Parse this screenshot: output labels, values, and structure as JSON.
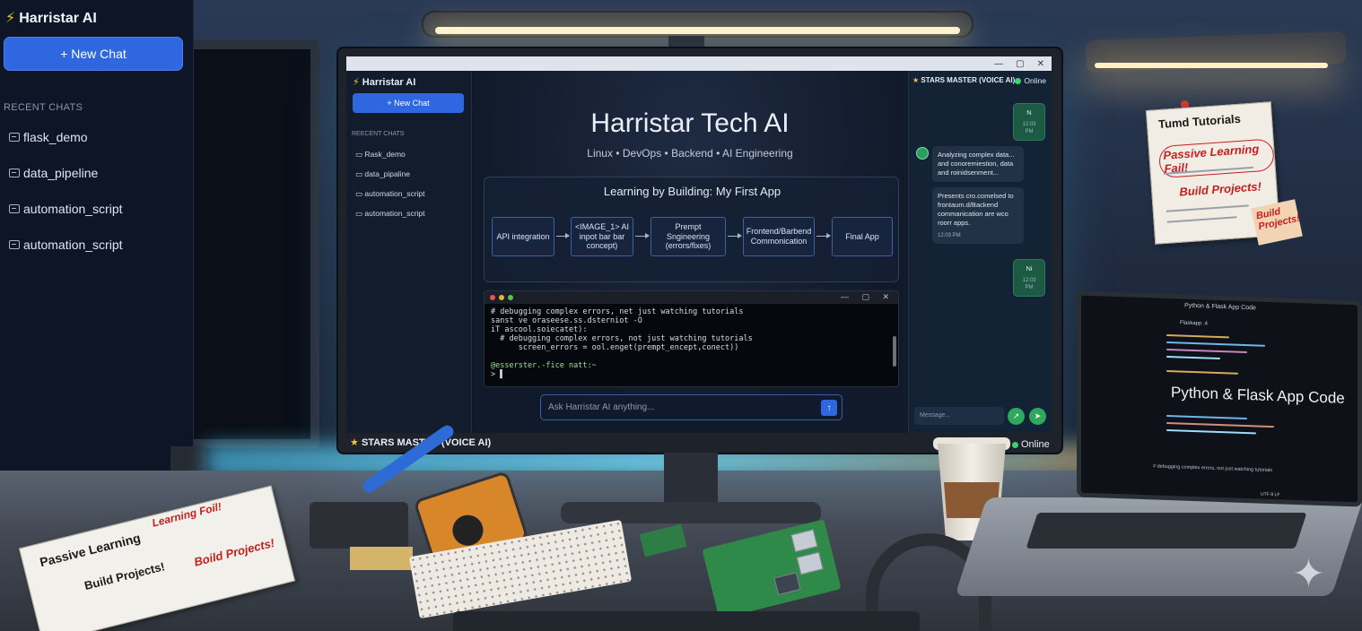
{
  "sidebar": {
    "brand": "Harristar AI",
    "new_chat": "+ New Chat",
    "recent_heading": "RECENT CHATS",
    "items": [
      {
        "label": "flask_demo"
      },
      {
        "label": "data_pipeline"
      },
      {
        "label": "automation_script"
      },
      {
        "label": "automation_script"
      }
    ]
  },
  "monitor": {
    "window_controls": [
      "—",
      "▢",
      "✕"
    ],
    "app_sidebar": {
      "brand": "Harristar AI",
      "new_chat": "+ New Chat",
      "recent_heading": "REECENT CHATS",
      "items": [
        {
          "label": "Rask_demo"
        },
        {
          "label": "data_pipaline"
        },
        {
          "label": "automation_script"
        },
        {
          "label": "automation_script"
        }
      ]
    },
    "hero": {
      "title": "Harristar Tech AI",
      "subtitle": "Linux • DevOps • Backend • AI Engineering"
    },
    "flow": {
      "title": "Learning by Building: My First App",
      "nodes": [
        "API integration",
        "<IMAGE_1> AI inpot bar bar concept)",
        "Prempt Sngineering (errors/fixes)",
        "Frontend/Barbend Commonication",
        "Final App"
      ]
    },
    "terminal": {
      "controls": "— ▢ ✕",
      "lines": [
        "# debugging complex errors, net just watching tutorials",
        "sanst ve oraseese.ss.dsterniot -O",
        "iT ascool.soiecatet):",
        "  # debugging complex errors, not just watching tutorials",
        "      screen_errors = ool.enget(prempt_encept,conect))",
        "",
        "@esserster.-fice natt:~",
        "> ▌"
      ]
    },
    "ask_placeholder": "Ask Harristar AI anything...",
    "voice_panel": {
      "title": "STARS MASTER (VOICE AI)",
      "status": "Online",
      "messages": [
        {
          "role": "user",
          "text": "N",
          "time": "12:03 PM"
        },
        {
          "role": "bot",
          "text": "Analyzing complex data... and conoremiestion, data and roinidsenment..."
        },
        {
          "role": "bot",
          "text": "Presents cro.comelsed to frontaum.d/Backend commanication are wco roorr apps.",
          "time": "12:03 PM"
        },
        {
          "role": "user",
          "text": "Ni",
          "time": "12:03 PM"
        }
      ],
      "message_placeholder": "Message..."
    },
    "bezel_label": "STARS MASTER (VOICE AI)",
    "bezel_status": "Online"
  },
  "wall_note": {
    "title": "Tumd Tutorials",
    "line1": "Passive Learning Fail!",
    "line2": "Build Projects!",
    "tag": "Build Projects!"
  },
  "desk_papers": {
    "title": "Passive Learning",
    "note1": "Learning Foil!",
    "title2": "Build Projects!",
    "note2": "Boild Projects!"
  },
  "laptop": {
    "window_title": "Python & Flask App Code",
    "tab": "Flaskapp .4",
    "headline": "Python & Flask App Code",
    "terminal_lines": [
      "# debugging complex errors, not just watching tutorials"
    ],
    "status": "UTF-8  LF"
  },
  "colors": {
    "accent": "#2f67e0",
    "online": "#3bd16f",
    "highlight": "#f7c531"
  }
}
